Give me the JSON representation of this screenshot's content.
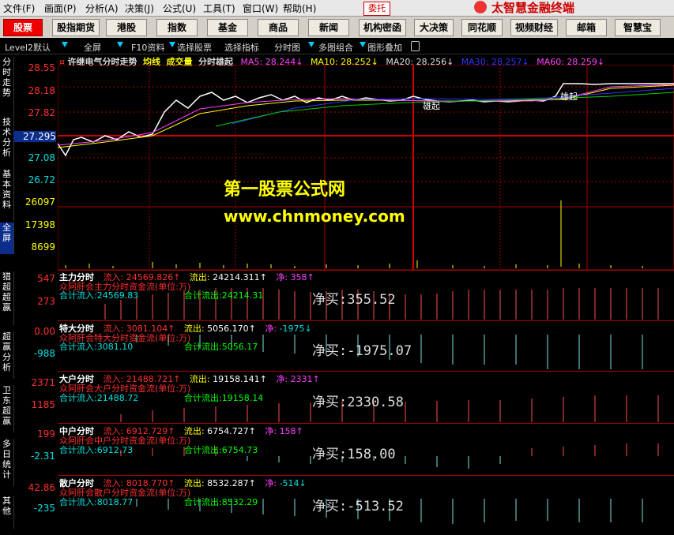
{
  "menu": [
    {
      "label": "文件(F)"
    },
    {
      "label": "画面(P)"
    },
    {
      "label": "分析(A)"
    },
    {
      "label": "决策(J)"
    },
    {
      "label": "公式(U)"
    },
    {
      "label": "工具(T)"
    },
    {
      "label": "窗口(W)"
    },
    {
      "label": "帮助(H)"
    }
  ],
  "trade_button": "委托",
  "brand": "太智慧金融终端",
  "nav": [
    {
      "label": "股票",
      "active": true
    },
    {
      "label": "股指期货"
    },
    {
      "label": "港股"
    },
    {
      "label": "指数"
    },
    {
      "label": "基金"
    },
    {
      "label": "商品"
    },
    {
      "label": "新闻"
    },
    {
      "label": "机构密函"
    },
    {
      "label": "大决策"
    },
    {
      "label": "同花顺"
    },
    {
      "label": "视频财经"
    },
    {
      "label": "邮箱"
    },
    {
      "label": "智慧宝"
    }
  ],
  "toolbar": {
    "level2": "Level2默认",
    "fullscreen": "全屏",
    "f10": "F10资料",
    "select_stock": "选择股票",
    "select_indicator": "选择指标",
    "intraday": "分时图",
    "multi_combo": "多图组合",
    "overlay": "图形叠加"
  },
  "title": {
    "stock": "许继电气分时走势",
    "avg": "均线",
    "volume": "成交量",
    "feature": "分时雄起",
    "ma5": "MA5: 28.244↓",
    "ma10": "MA10: 28.252↓",
    "ma20": "MA20: 28.256↓",
    "ma30": "MA30: 28.257↓",
    "ma60": "MA60: 28.259↓"
  },
  "side_tabs": [
    "分时走势",
    "技术分析",
    "基本资料",
    "全屏",
    "猎超超赢",
    "超赢分析",
    "卫东超赢",
    "多日统计",
    "其他"
  ],
  "price_axis": [
    "28.55",
    "28.18",
    "27.82",
    "27.295",
    "27.08",
    "26.72"
  ],
  "current_price": "27.295",
  "volume_axis": [
    "26097",
    "17398",
    "8699"
  ],
  "annotations": {
    "xiongqi": "雄起"
  },
  "watermark": {
    "line1": "第一股票公式网",
    "line2": "www.chnmoney.com"
  },
  "panes": [
    {
      "title": "主力分时",
      "in_label": "流入:",
      "in": "24569.826↑",
      "out_label": "流出:",
      "out": "24214.311↑",
      "net_label": "净:",
      "net": "358↑",
      "desc": "众阿肝会主力分时资金流(单位:万)",
      "sum_in": "合计流入:24569.83",
      "sum_out": "合计流出:24214.31",
      "net_big": "净买:355.52",
      "axis": [
        "547",
        "273"
      ]
    },
    {
      "title": "特大分时",
      "in_label": "流入:",
      "in": "3081.104↑",
      "out_label": "流出:",
      "out": "5056.170↑",
      "net_label": "净:",
      "net": "-1975↓",
      "desc": "众阿肝会特大分时资金流(单位:万)",
      "sum_in": "合计流入:3081.10",
      "sum_out": "合计流出:5056.17",
      "net_big": "净买:-1975.07",
      "axis": [
        "0.00",
        "-988"
      ]
    },
    {
      "title": "大户分时",
      "in_label": "流入:",
      "in": "21488.721↑",
      "out_label": "流出:",
      "out": "19158.141↑",
      "net_label": "净:",
      "net": "2331↑",
      "desc": "众阿肝会大户分时资金流(单位:万)",
      "sum_in": "合计流入:21488.72",
      "sum_out": "合计流出:19158.14",
      "net_big": "净买:2330.58",
      "axis": [
        "2371",
        "1185"
      ]
    },
    {
      "title": "中户分时",
      "in_label": "流入:",
      "in": "6912.729↑",
      "out_label": "流出:",
      "out": "6754.727↑",
      "net_label": "净:",
      "net": "158↑",
      "desc": "众阿肝会中户分时资金流(单位:万)",
      "sum_in": "合计流入:6912.73",
      "sum_out": "合计流出:6754.73",
      "net_big": "净买:158.00",
      "axis": [
        "199",
        "-2.31"
      ]
    },
    {
      "title": "散户分时",
      "in_label": "流入:",
      "in": "8018.770↑",
      "out_label": "流出:",
      "out": "8532.287↑",
      "net_label": "净:",
      "net": "-514↓",
      "desc": "众阿肝会散户分时资金流(单位:万)",
      "sum_in": "合计流入:8018.77",
      "sum_out": "合计流出:8532.29",
      "net_big": "净买:-513.52",
      "axis": [
        "42.86",
        "-235"
      ]
    }
  ],
  "colors": {
    "up": "#ff3030",
    "down": "#00e0e0",
    "grid": "#a00000",
    "accent": "#ffff00",
    "magenta": "#ff40ff"
  }
}
